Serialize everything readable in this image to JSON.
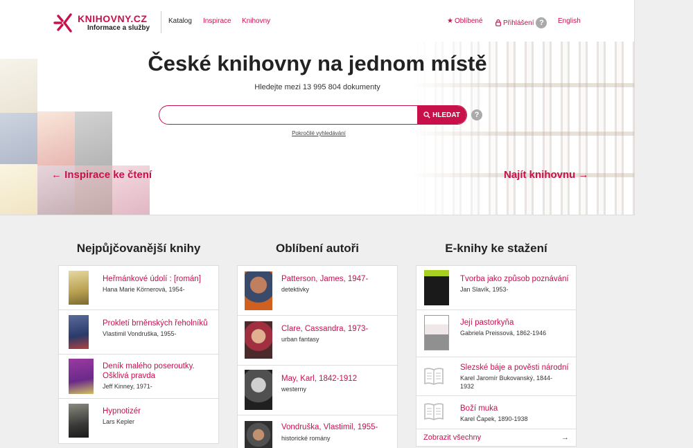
{
  "header": {
    "logo_title": "KNIHOVNY.CZ",
    "logo_subtitle": "Informace a služby",
    "nav": [
      "Katalog",
      "Inspirace",
      "Knihovny"
    ],
    "favorites": "Oblíbené",
    "login": "Přihlášení",
    "help": "?",
    "language": "English"
  },
  "hero": {
    "title": "České knihovny na jednom místě",
    "subtitle": "Hledejte mezi 13 995 804 dokumenty",
    "search_placeholder": "",
    "search_button": "HLEDAT",
    "advanced_search": "Pokročilé vyhledávání",
    "inspiration_link": "Inspirace ke čtení",
    "find_library_link": "Najít knihovnu"
  },
  "colors": {
    "accent": "#c8104a",
    "background": "#efefef"
  },
  "columns": {
    "borrowed": {
      "title": "Nejpůjčovanější knihy",
      "items": [
        {
          "title": "Heřmánkové údolí : [román]",
          "sub": "Hana Marie Körnerová, 1954-"
        },
        {
          "title": "Prokletí brněnských řeholníků",
          "sub": "Vlastimil Vondruška, 1955-"
        },
        {
          "title": "Deník malého poseroutky. Ošklivá pravda",
          "sub": "Jeff Kinney, 1971-"
        },
        {
          "title": "Hypnotizér",
          "sub": "Lars Kepler"
        }
      ]
    },
    "authors": {
      "title": "Oblíbení autoři",
      "items": [
        {
          "title": "Patterson, James, 1947-",
          "sub": "detektivky"
        },
        {
          "title": "Clare, Cassandra, 1973-",
          "sub": "urban fantasy"
        },
        {
          "title": "May, Karl, 1842-1912",
          "sub": "westerny"
        },
        {
          "title": "Vondruška, Vlastimil, 1955-",
          "sub": "historické romány"
        }
      ]
    },
    "ebooks": {
      "title": "E-knihy ke stažení",
      "items": [
        {
          "title": "Tvorba jako způsob poznávání",
          "sub": "Jan Slavík, 1953-"
        },
        {
          "title": "Její pastorkyňa",
          "sub": "Gabriela Preissová, 1862-1946"
        },
        {
          "title": "Slezské báje a pověsti národní",
          "sub": "Karel Jaromír Bukovanský, 1844-1932"
        },
        {
          "title": "Boží muka",
          "sub": "Karel Čapek, 1890-1938"
        }
      ],
      "show_all": "Zobrazit všechny"
    }
  }
}
